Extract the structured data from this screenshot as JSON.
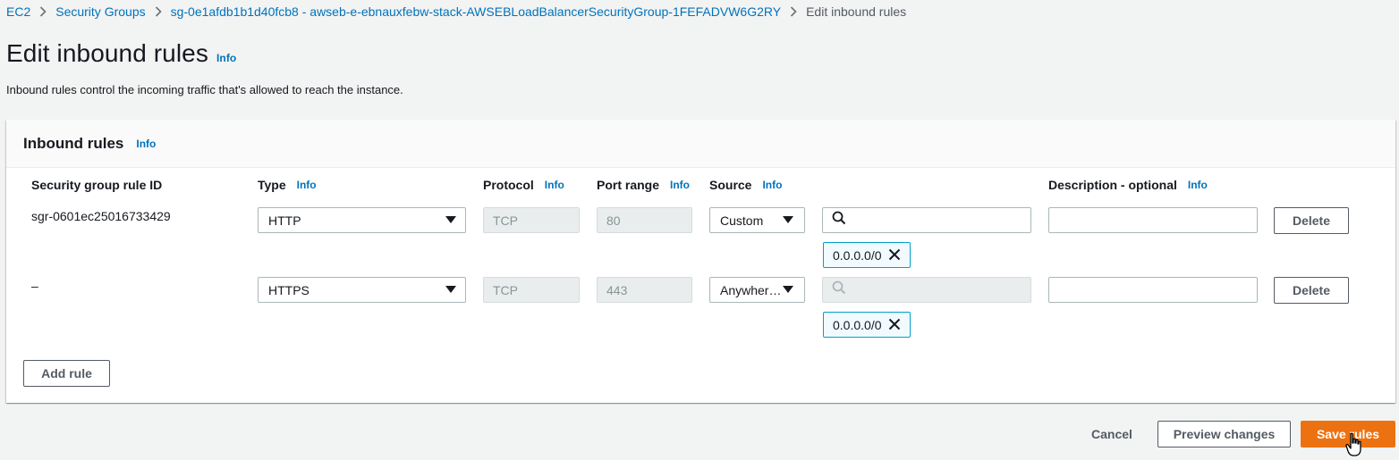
{
  "breadcrumb": {
    "items": [
      "EC2",
      "Security Groups",
      "sg-0e1afdb1b1d40fcb8 - awseb-e-ebnauxfebw-stack-AWSEBLoadBalancerSecurityGroup-1FEFADVW6G2RY"
    ],
    "current": "Edit inbound rules"
  },
  "header": {
    "title": "Edit inbound rules",
    "info": "Info",
    "description": "Inbound rules control the incoming traffic that's allowed to reach the instance."
  },
  "panel": {
    "title": "Inbound rules",
    "info": "Info",
    "columns": {
      "rule_id": "Security group rule ID",
      "type": "Type",
      "protocol": "Protocol",
      "port_range": "Port range",
      "source": "Source",
      "description": "Description - optional",
      "info": "Info"
    },
    "rows": [
      {
        "rule_id": "sgr-0601ec25016733429",
        "type": "HTTP",
        "protocol": "TCP",
        "port": "80",
        "source": "Custom",
        "search_value": "",
        "cidr": "0.0.0.0/0",
        "description": "",
        "delete": "Delete"
      },
      {
        "rule_id": "–",
        "type": "HTTPS",
        "protocol": "TCP",
        "port": "443",
        "source": "Anywher…",
        "search_value": "",
        "cidr": "0.0.0.0/0",
        "description": "",
        "delete": "Delete"
      }
    ],
    "add_rule": "Add rule"
  },
  "footer": {
    "cancel": "Cancel",
    "preview": "Preview changes",
    "save": "Save rules"
  },
  "colors": {
    "link": "#0073bb",
    "primary": "#ec7211",
    "token_border": "#00a1c9"
  }
}
